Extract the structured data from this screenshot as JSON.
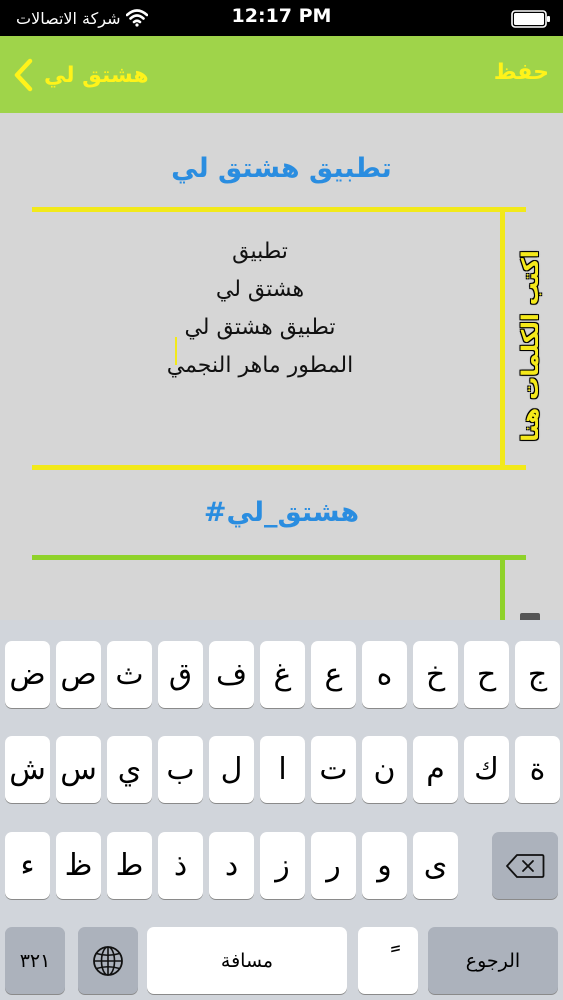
{
  "status_bar": {
    "carrier": "شركة الاتصالات",
    "time": "12:17 PM"
  },
  "nav": {
    "back_label": "هشتق لي",
    "save_label": "حفظ"
  },
  "main": {
    "app_title": "تطبيق هشتق لي",
    "input_text": "تطبيق\nهشتق لي\nتطبيق هشتق لي\nالمطور ماهر النجمي",
    "side_label": "اكتب الكلمات هنا",
    "hashtag_result": "#هشتق_لي"
  },
  "keyboard": {
    "row1": [
      "ض",
      "ص",
      "ث",
      "ق",
      "ف",
      "غ",
      "ع",
      "ه",
      "خ",
      "ح",
      "ج"
    ],
    "row2": [
      "ش",
      "س",
      "ي",
      "ب",
      "ل",
      "ا",
      "ت",
      "ن",
      "م",
      "ك",
      "ة"
    ],
    "row3": [
      "ء",
      "ظ",
      "ط",
      "ذ",
      "د",
      "ز",
      "ر",
      "و",
      "ى"
    ],
    "numbers_key": "٣٢١",
    "space_label": "مسافة",
    "diacritic_key": "ً",
    "return_label": "الرجوع"
  },
  "colors": {
    "nav_bar": "#9fd44a",
    "nav_text": "#fff31a",
    "title_blue": "#2a8de0",
    "yellow_line": "#f2e91a",
    "green_line": "#8fd22a"
  }
}
